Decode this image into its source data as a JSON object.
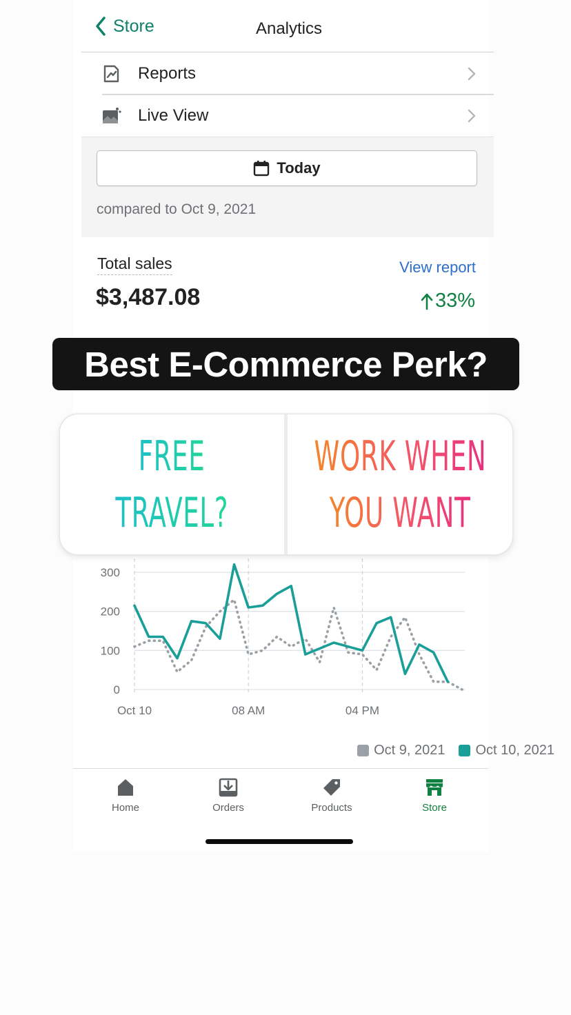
{
  "nav": {
    "back_label": "Store",
    "title": "Analytics"
  },
  "menu": {
    "items": [
      {
        "label": "Reports",
        "icon": "reports-icon"
      },
      {
        "label": "Live View",
        "icon": "live-view-icon"
      }
    ]
  },
  "filter": {
    "date_label": "Today",
    "compare_text": "compared to Oct 9, 2021"
  },
  "sales": {
    "label": "Total sales",
    "view_report": "View report",
    "value": "$3,487.08",
    "change": "33%",
    "change_color": "#108043"
  },
  "overlay": {
    "banner": "Best E-Commerce Perk?",
    "poll": {
      "option_a": [
        "FREE",
        "TRAVEL?"
      ],
      "option_b": [
        "WORK WHEN",
        "YOU WANT"
      ]
    }
  },
  "chart_data": {
    "type": "line",
    "x_ticks": [
      "Oct 10",
      "08 AM",
      "04 PM"
    ],
    "x_tick_hours": [
      0,
      8,
      16
    ],
    "ylim": [
      0,
      300
    ],
    "y_ticks": [
      "0",
      "100",
      "200",
      "300"
    ],
    "x": [
      0,
      1,
      2,
      3,
      4,
      5,
      6,
      7,
      8,
      9,
      10,
      11,
      12,
      13,
      14,
      15,
      16,
      17,
      18,
      19,
      20,
      21,
      22,
      23
    ],
    "series": [
      {
        "name": "Oct 9, 2021",
        "color": "#9aa0a6",
        "style": "dotted",
        "values": [
          110,
          125,
          125,
          45,
          75,
          160,
          200,
          230,
          90,
          100,
          135,
          110,
          130,
          70,
          210,
          95,
          90,
          50,
          135,
          185,
          90,
          20,
          20,
          0
        ]
      },
      {
        "name": "Oct 10, 2021",
        "color": "#1a9e98",
        "style": "solid",
        "values": [
          215,
          135,
          135,
          80,
          175,
          170,
          130,
          320,
          210,
          215,
          245,
          265,
          90,
          105,
          120,
          110,
          100,
          170,
          185,
          40,
          115,
          95,
          20
        ]
      }
    ],
    "grid": true,
    "legend": "bottom-right"
  },
  "tabs": [
    {
      "label": "Home",
      "icon": "home-icon"
    },
    {
      "label": "Orders",
      "icon": "orders-icon"
    },
    {
      "label": "Products",
      "icon": "products-tag-icon"
    },
    {
      "label": "Store",
      "icon": "store-icon"
    }
  ],
  "colors": {
    "accent": "#108043",
    "teal_series": "#1a9e98",
    "link": "#2c6ecb"
  }
}
